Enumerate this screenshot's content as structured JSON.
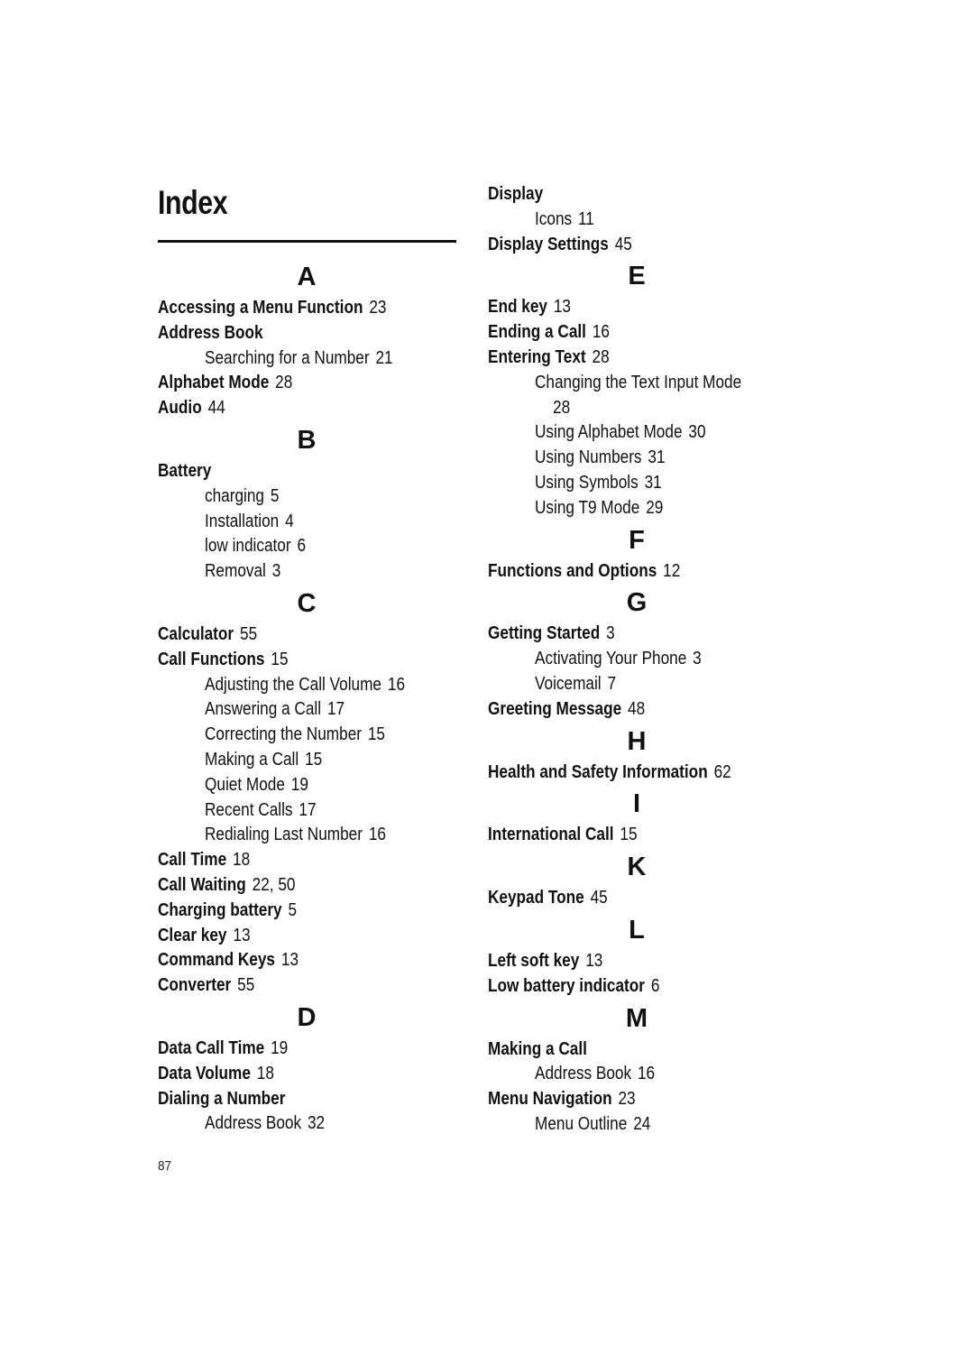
{
  "page": {
    "title": "Index",
    "page_number": "87"
  },
  "left_column": [
    {
      "type": "letter",
      "text": "A"
    },
    {
      "type": "entry",
      "term": "Accessing a Menu Function",
      "pages": "23"
    },
    {
      "type": "entry",
      "term": "Address Book",
      "pages": ""
    },
    {
      "type": "sub",
      "term": "Searching for a Number",
      "pages": "21"
    },
    {
      "type": "entry",
      "term": "Alphabet Mode",
      "pages": "28"
    },
    {
      "type": "entry",
      "term": "Audio",
      "pages": "44"
    },
    {
      "type": "letter",
      "text": "B"
    },
    {
      "type": "entry",
      "term": "Battery",
      "pages": ""
    },
    {
      "type": "sub",
      "term": "charging",
      "pages": "5"
    },
    {
      "type": "sub",
      "term": "Installation",
      "pages": "4"
    },
    {
      "type": "sub",
      "term": "low indicator",
      "pages": "6"
    },
    {
      "type": "sub",
      "term": "Removal",
      "pages": "3"
    },
    {
      "type": "letter",
      "text": "C"
    },
    {
      "type": "entry",
      "term": "Calculator",
      "pages": "55"
    },
    {
      "type": "entry",
      "term": "Call Functions",
      "pages": "15"
    },
    {
      "type": "sub",
      "term": "Adjusting the Call Volume",
      "pages": "16"
    },
    {
      "type": "sub",
      "term": "Answering a Call",
      "pages": "17"
    },
    {
      "type": "sub",
      "term": "Correcting the Number",
      "pages": "15"
    },
    {
      "type": "sub",
      "term": "Making a Call",
      "pages": "15"
    },
    {
      "type": "sub",
      "term": "Quiet Mode",
      "pages": "19"
    },
    {
      "type": "sub",
      "term": "Recent Calls",
      "pages": "17"
    },
    {
      "type": "sub",
      "term": "Redialing Last Number",
      "pages": "16"
    },
    {
      "type": "entry",
      "term": "Call Time",
      "pages": "18"
    },
    {
      "type": "entry",
      "term": "Call Waiting",
      "pages": "22, 50"
    },
    {
      "type": "entry",
      "term": "Charging battery",
      "pages": "5"
    },
    {
      "type": "entry",
      "term": "Clear key",
      "pages": "13"
    },
    {
      "type": "entry",
      "term": "Command Keys",
      "pages": "13"
    },
    {
      "type": "entry",
      "term": "Converter",
      "pages": "55"
    },
    {
      "type": "letter",
      "text": "D"
    },
    {
      "type": "entry",
      "term": "Data Call Time",
      "pages": "19"
    },
    {
      "type": "entry",
      "term": "Data Volume",
      "pages": "18"
    },
    {
      "type": "entry",
      "term": "Dialing a Number",
      "pages": ""
    },
    {
      "type": "sub",
      "term": "Address Book",
      "pages": "32"
    }
  ],
  "right_column": [
    {
      "type": "entry",
      "term": "Display",
      "pages": ""
    },
    {
      "type": "sub",
      "term": "Icons",
      "pages": "11"
    },
    {
      "type": "entry",
      "term": "Display Settings",
      "pages": "45"
    },
    {
      "type": "letter",
      "text": "E"
    },
    {
      "type": "entry",
      "term": "End key",
      "pages": "13"
    },
    {
      "type": "entry",
      "term": "Ending a Call",
      "pages": "16"
    },
    {
      "type": "entry",
      "term": "Entering Text",
      "pages": "28"
    },
    {
      "type": "sub",
      "term": "Changing the Text Input Mode",
      "pages": ""
    },
    {
      "type": "cont",
      "term": "",
      "pages": "28"
    },
    {
      "type": "sub",
      "term": "Using Alphabet Mode",
      "pages": "30"
    },
    {
      "type": "sub",
      "term": "Using Numbers",
      "pages": "31"
    },
    {
      "type": "sub",
      "term": "Using Symbols",
      "pages": "31"
    },
    {
      "type": "sub",
      "term": "Using T9 Mode",
      "pages": "29"
    },
    {
      "type": "letter",
      "text": "F"
    },
    {
      "type": "entry",
      "term": "Functions and Options",
      "pages": "12"
    },
    {
      "type": "letter",
      "text": "G"
    },
    {
      "type": "entry",
      "term": "Getting Started",
      "pages": "3"
    },
    {
      "type": "sub",
      "term": "Activating Your Phone",
      "pages": "3"
    },
    {
      "type": "sub",
      "term": "Voicemail",
      "pages": "7"
    },
    {
      "type": "entry",
      "term": "Greeting Message",
      "pages": "48"
    },
    {
      "type": "letter",
      "text": "H"
    },
    {
      "type": "entry",
      "term": "Health and Safety Information",
      "pages": "62"
    },
    {
      "type": "letter",
      "text": "I"
    },
    {
      "type": "entry",
      "term": "International Call",
      "pages": "15"
    },
    {
      "type": "letter",
      "text": "K"
    },
    {
      "type": "entry",
      "term": "Keypad Tone",
      "pages": "45"
    },
    {
      "type": "letter",
      "text": "L"
    },
    {
      "type": "entry",
      "term": "Left soft key",
      "pages": "13"
    },
    {
      "type": "entry",
      "term": "Low battery indicator",
      "pages": "6"
    },
    {
      "type": "letter",
      "text": "M"
    },
    {
      "type": "entry",
      "term": "Making a Call",
      "pages": ""
    },
    {
      "type": "sub",
      "term": "Address Book",
      "pages": "16"
    },
    {
      "type": "entry",
      "term": "Menu Navigation",
      "pages": "23"
    },
    {
      "type": "sub",
      "term": "Menu Outline",
      "pages": "24"
    }
  ]
}
